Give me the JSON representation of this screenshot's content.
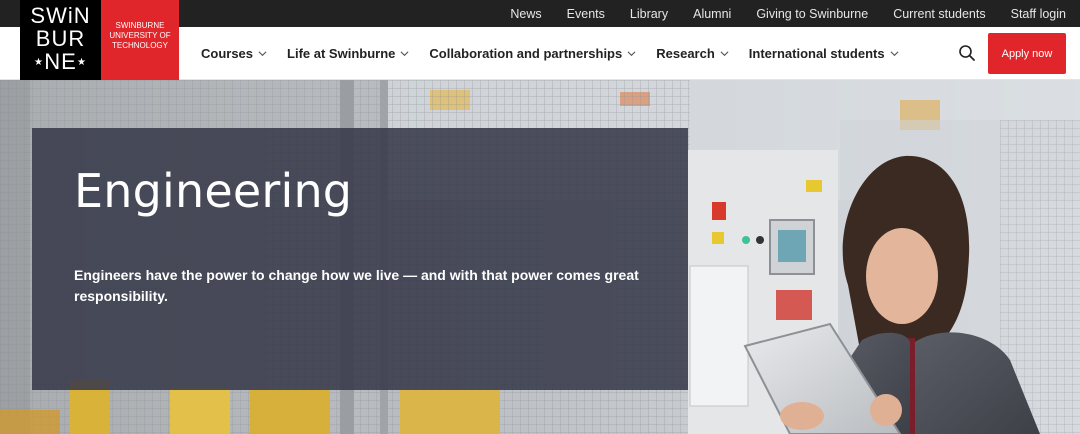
{
  "utility_nav": {
    "links": [
      "News",
      "Events",
      "Library",
      "Alumni",
      "Giving to Swinburne",
      "Current students",
      "Staff login"
    ]
  },
  "logo": {
    "wordmark_lines": [
      "SWiN",
      "BUR",
      "NE"
    ],
    "institution_lines": [
      "SWINBURNE",
      "UNIVERSITY OF",
      "TECHNOLOGY"
    ]
  },
  "main_nav": {
    "items": [
      {
        "label": "Courses",
        "icon": "chevron-down-icon"
      },
      {
        "label": "Life at Swinburne",
        "icon": "chevron-down-icon"
      },
      {
        "label": "Collaboration and partnerships",
        "icon": "chevron-down-icon"
      },
      {
        "label": "Research",
        "icon": "chevron-down-icon"
      },
      {
        "label": "International students",
        "icon": "chevron-down-icon"
      }
    ],
    "search_icon": "search-icon",
    "apply_label": "Apply now"
  },
  "hero": {
    "title": "Engineering",
    "subtitle": "Engineers have the power to change how we live — and with that power comes great responsibility."
  },
  "colors": {
    "brand_red": "#e0262a",
    "utility_bar": "#222222",
    "panel": "#383a4a"
  }
}
